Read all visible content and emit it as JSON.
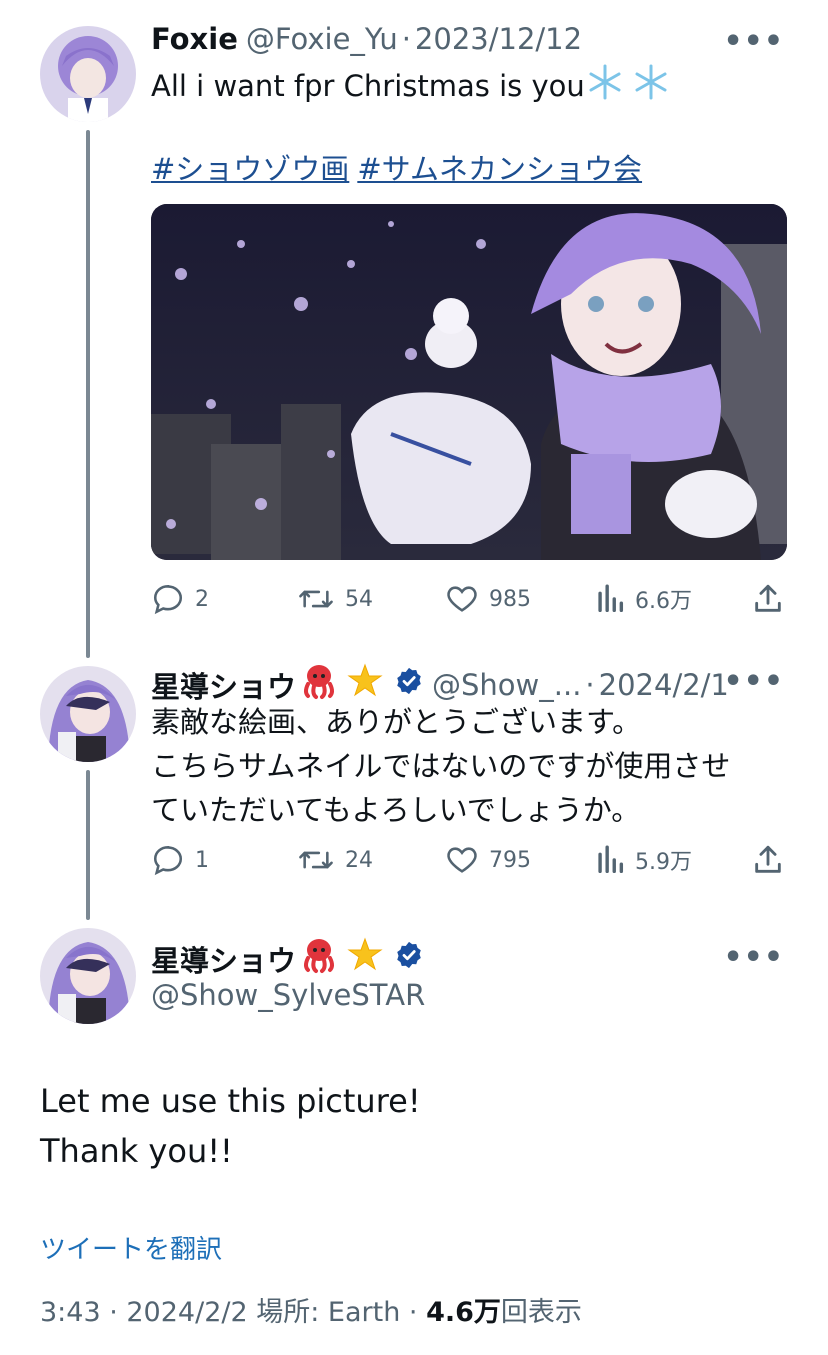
{
  "tweet1": {
    "name": "Foxie",
    "handle": "@Foxie_Yu",
    "date": "2023/12/12",
    "text": "All i want fpr Christmas is you",
    "hashtags": [
      "#ショウゾウ画",
      "#サムネカンショウ会"
    ],
    "actions": {
      "replies": "2",
      "retweets": "54",
      "likes": "985",
      "views": "6.6万"
    }
  },
  "tweet2": {
    "name": "星導ショウ",
    "handle": "@Show_...",
    "date": "2024/2/1",
    "text_lines": [
      "素敵な絵画、ありがとうございます。",
      "こちらサムネイルではないのですが使用させ",
      "ていただいてもよろしいでしょうか。"
    ],
    "actions": {
      "replies": "1",
      "retweets": "24",
      "likes": "795",
      "views": "5.9万"
    }
  },
  "main": {
    "name": "星導ショウ",
    "handle": "@Show_SylveSTAR",
    "text_lines": [
      "Let me use this picture!",
      "Thank you!!"
    ],
    "translate": "ツイートを翻訳",
    "meta_time": "3:43 · 2024/2/2 場所: Earth · ",
    "meta_views": "4.6万",
    "meta_views_suffix": "回表示"
  },
  "separator": "·",
  "more_label": "•••",
  "colors": {
    "text": "#0f1419",
    "secondary": "#536471",
    "link": "#1d6fb8",
    "verified": "#1a4fa0"
  }
}
